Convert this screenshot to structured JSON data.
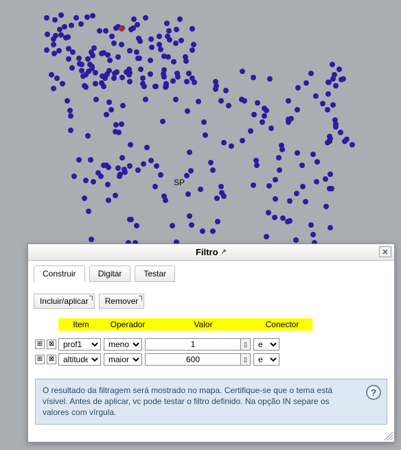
{
  "map": {
    "label": "SP"
  },
  "dialog": {
    "title": "Filtro",
    "tabs": [
      "Construir",
      "Digitar",
      "Testar"
    ],
    "active_tab": 0,
    "actions": {
      "include": "Incluir/aplicar",
      "remove": "Remover"
    },
    "headers": {
      "item": "Item",
      "operator": "Operador",
      "value": "Valor",
      "connector": "Conector"
    },
    "rows": [
      {
        "item": "prof1",
        "operator": "menor",
        "value": "1",
        "connector": "e"
      },
      {
        "item": "altitude",
        "operator": "maior",
        "value": "600",
        "connector": "e"
      }
    ],
    "info_text": "O resultado da filtragem será mostrado no mapa. Certifique-se que o tema está vísivel. Antes de aplicar, vc pode testar o filtro definido. Na opção IN separe os valores com vírgula.",
    "icons": {
      "expand": "⊞",
      "delete": "⊠",
      "close": "✕",
      "popout": "↗",
      "help": "?"
    }
  }
}
